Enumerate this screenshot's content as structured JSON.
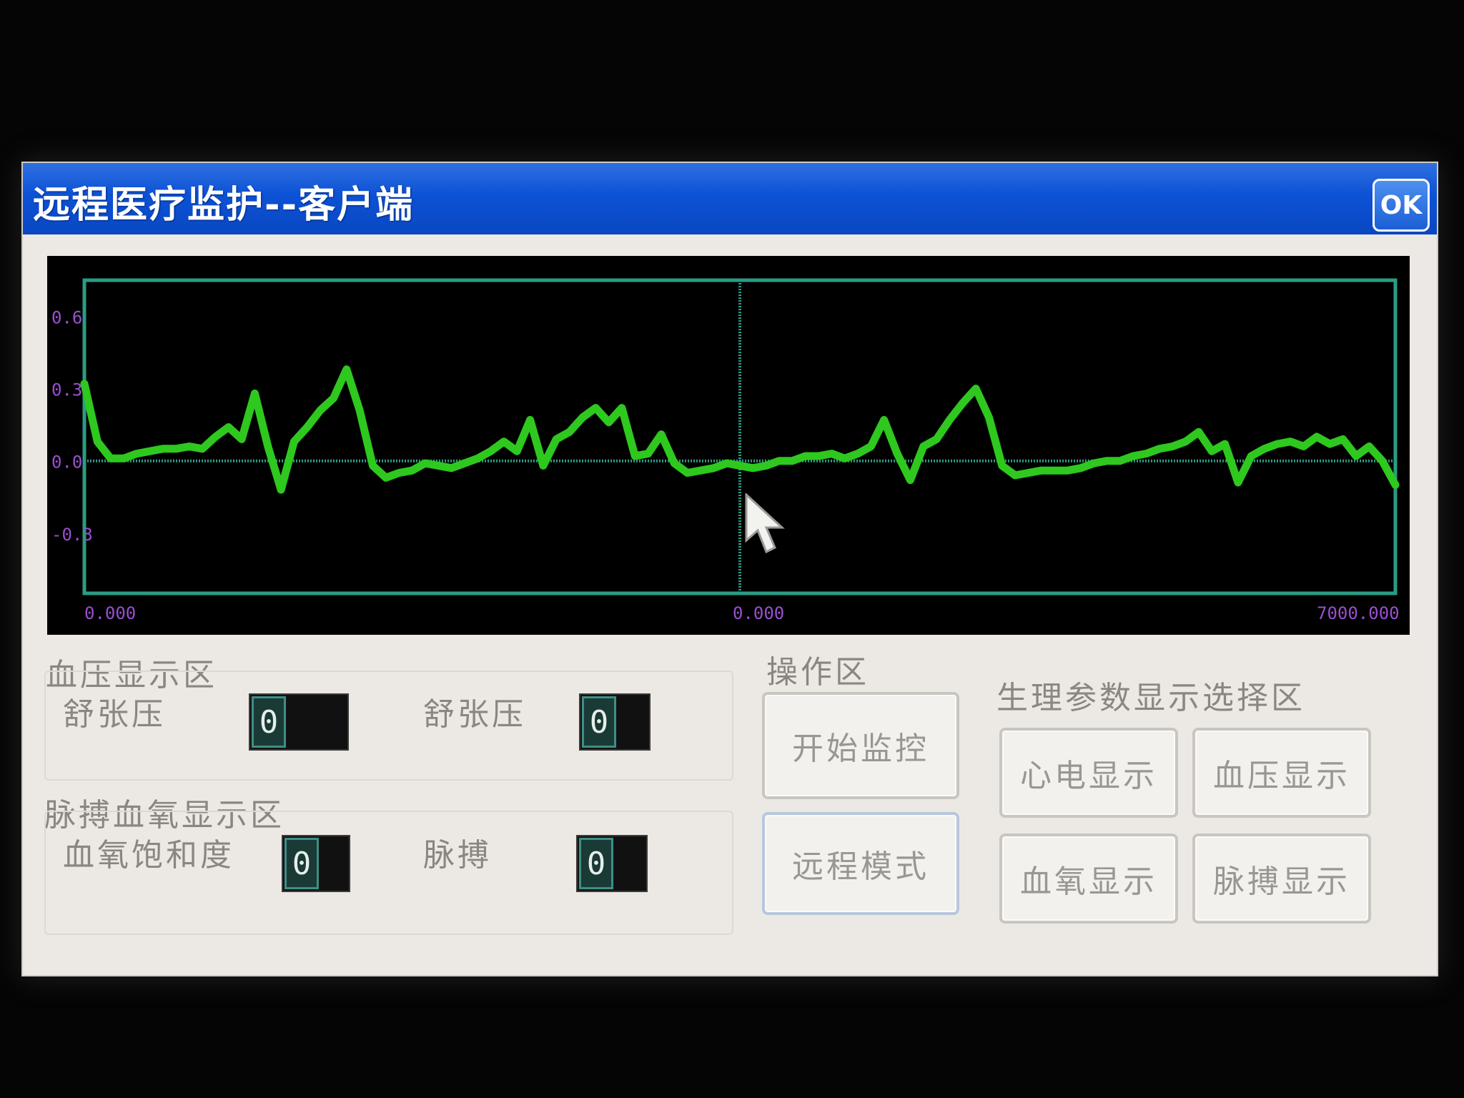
{
  "window": {
    "title": "远程医疗监护--客户端",
    "ok_label": "OK"
  },
  "chart_data": {
    "type": "line",
    "title": "",
    "xlabel": "",
    "ylabel": "",
    "x_tick_labels": [
      "0.000",
      "0.000",
      "7000.000"
    ],
    "y_tick_labels": [
      "0.6",
      "0.3",
      "0.0",
      "-0.3"
    ],
    "grid": true,
    "series": [
      {
        "x": [
          0,
          10,
          20,
          30,
          40,
          50,
          60,
          70,
          80,
          90,
          100,
          110,
          120,
          130,
          140,
          150,
          160,
          170,
          180,
          190,
          200,
          210,
          220,
          230,
          240,
          250,
          260,
          270,
          280,
          290,
          300,
          310,
          320,
          330,
          340,
          350,
          360,
          370,
          380,
          390,
          400,
          410,
          420,
          430,
          440,
          450,
          460,
          470,
          480,
          490,
          500,
          510,
          520,
          530,
          540,
          550,
          560,
          570,
          580,
          590,
          600,
          610,
          620,
          630,
          640,
          650,
          660,
          670,
          680,
          690,
          700,
          710,
          720,
          730,
          740,
          750,
          760,
          770,
          780,
          790,
          800,
          810,
          820,
          830,
          840,
          850,
          860,
          870,
          880,
          890,
          900,
          910,
          920,
          930,
          940,
          950,
          960,
          970,
          980,
          990,
          1000
        ],
        "y": [
          0.32,
          0.08,
          0.01,
          0.01,
          0.03,
          0.04,
          0.05,
          0.05,
          0.06,
          0.05,
          0.1,
          0.14,
          0.09,
          0.28,
          0.06,
          -0.12,
          0.08,
          0.14,
          0.21,
          0.26,
          0.38,
          0.21,
          -0.02,
          -0.07,
          -0.05,
          -0.04,
          -0.01,
          -0.02,
          -0.03,
          -0.01,
          0.01,
          0.04,
          0.08,
          0.04,
          0.17,
          -0.02,
          0.09,
          0.12,
          0.18,
          0.22,
          0.16,
          0.22,
          0.02,
          0.03,
          0.11,
          -0.01,
          -0.05,
          -0.04,
          -0.03,
          -0.01,
          -0.02,
          -0.03,
          -0.02,
          0.0,
          0.0,
          0.02,
          0.02,
          0.03,
          0.01,
          0.03,
          0.06,
          0.17,
          0.03,
          -0.08,
          0.06,
          0.09,
          0.17,
          0.24,
          0.3,
          0.18,
          -0.02,
          -0.06,
          -0.05,
          -0.04,
          -0.04,
          -0.04,
          -0.03,
          -0.01,
          0.0,
          0.0,
          0.02,
          0.03,
          0.05,
          0.06,
          0.08,
          0.12,
          0.04,
          0.07,
          -0.09,
          0.02,
          0.05,
          0.07,
          0.08,
          0.06,
          0.1,
          0.07,
          0.09,
          0.02,
          0.06,
          0.0,
          -0.1
        ]
      }
    ]
  },
  "bp_panel": {
    "title": "血压显示区",
    "dia_label": "舒张压",
    "sys_label": "舒张压",
    "dia_value": "0",
    "sys_value": "0"
  },
  "spo2_panel": {
    "title": "脉搏血氧显示区",
    "spo2_label": "血氧饱和度",
    "pulse_label": "脉搏",
    "spo2_value": "0",
    "pulse_value": "0"
  },
  "operation_panel": {
    "title": "操作区",
    "start_label": "开始监控",
    "remote_label": "远程模式"
  },
  "display_select_panel": {
    "title": "生理参数显示选择区",
    "ecg_label": "心电显示",
    "bp_label": "血压显示",
    "spo2_label": "血氧显示",
    "pulse_label": "脉搏显示"
  },
  "colors": {
    "title_bar": "#0c52d6",
    "waveform": "#2ec81e",
    "grid": "#2a9c84",
    "axis_text": "#9a4fd0"
  },
  "icons": {
    "cursor": "arrow-pointer"
  }
}
